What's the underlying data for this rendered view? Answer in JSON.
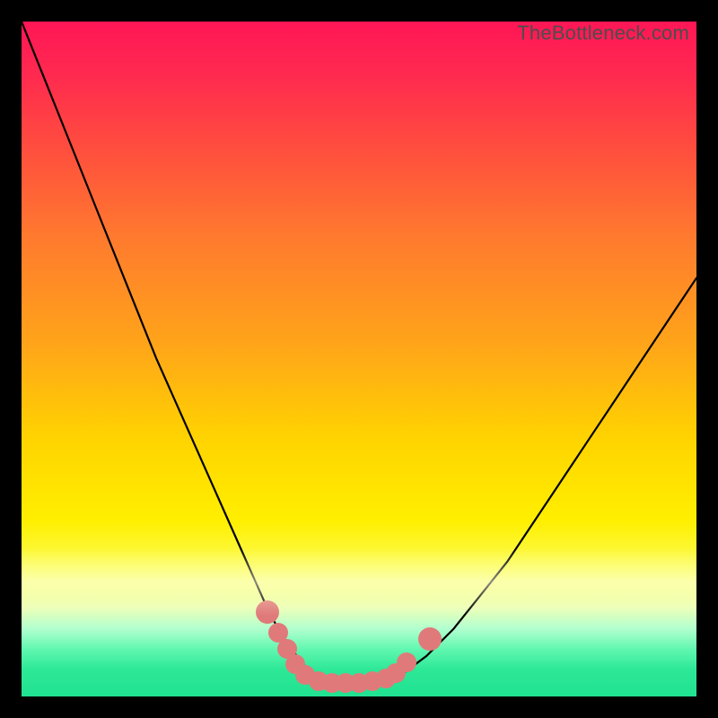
{
  "watermark": "TheBottleneck.com",
  "colors": {
    "frame": "#000000",
    "dot": "#e07a7a",
    "curve": "#000000"
  },
  "chart_data": {
    "type": "line",
    "title": "",
    "xlabel": "",
    "ylabel": "",
    "xlim": [
      0,
      100
    ],
    "ylim": [
      0,
      100
    ],
    "x": [
      0,
      4,
      8,
      12,
      16,
      20,
      24,
      28,
      32,
      36,
      38,
      40,
      42,
      44,
      46,
      48,
      50,
      52,
      56,
      60,
      64,
      68,
      72,
      76,
      80,
      84,
      88,
      92,
      96,
      100
    ],
    "y": [
      100,
      90,
      80,
      70,
      60,
      50,
      41,
      32,
      23,
      14,
      10,
      7,
      4.5,
      3,
      2.2,
      2,
      2,
      2.2,
      3,
      6,
      10,
      15,
      20,
      26,
      32,
      38,
      44,
      50,
      56,
      62
    ],
    "markers": [
      {
        "x": 36.5,
        "y": 12.5
      },
      {
        "x": 38.0,
        "y": 9.5
      },
      {
        "x": 39.3,
        "y": 7.0
      },
      {
        "x": 40.5,
        "y": 4.8
      },
      {
        "x": 42.0,
        "y": 3.2
      },
      {
        "x": 44.0,
        "y": 2.3
      },
      {
        "x": 46.0,
        "y": 2.0
      },
      {
        "x": 48.0,
        "y": 2.0
      },
      {
        "x": 50.0,
        "y": 2.0
      },
      {
        "x": 52.0,
        "y": 2.2
      },
      {
        "x": 54.0,
        "y": 2.6
      },
      {
        "x": 55.5,
        "y": 3.5
      },
      {
        "x": 57.0,
        "y": 5.0
      },
      {
        "x": 60.5,
        "y": 8.5
      }
    ]
  }
}
